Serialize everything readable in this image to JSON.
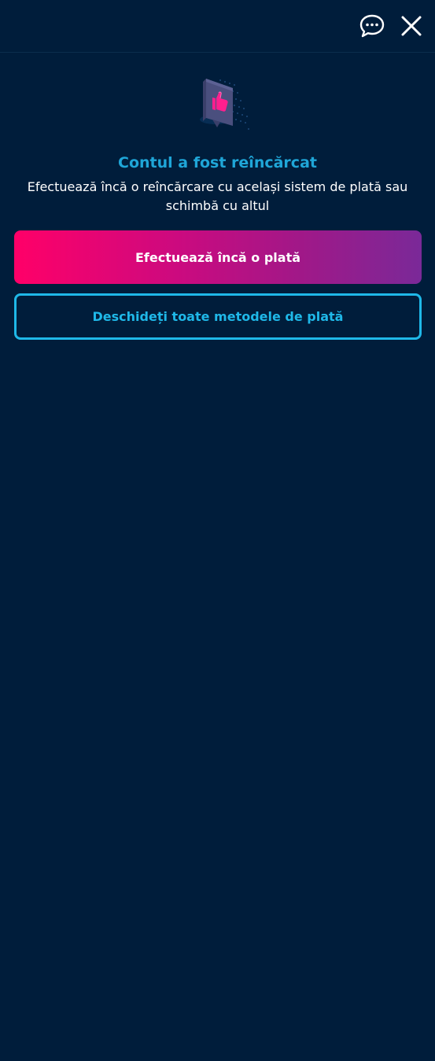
{
  "header": {
    "chat_icon": "chat-bubble-icon",
    "close_icon": "close-icon"
  },
  "success": {
    "illustration": "thumbs-up-card-icon",
    "title": "Contul a fost reîncărcat",
    "message": "Efectuează încă o reîncărcare cu același sistem de plată sau schimbă cu altul"
  },
  "actions": {
    "primary_label": "Efectuează încă o plată",
    "secondary_label": "Deschideți toate metodele de plată"
  },
  "colors": {
    "background": "#001d3b",
    "accent_blue": "#1fa6d8",
    "gradient_start": "#ff0068",
    "gradient_end": "#7a2998"
  }
}
